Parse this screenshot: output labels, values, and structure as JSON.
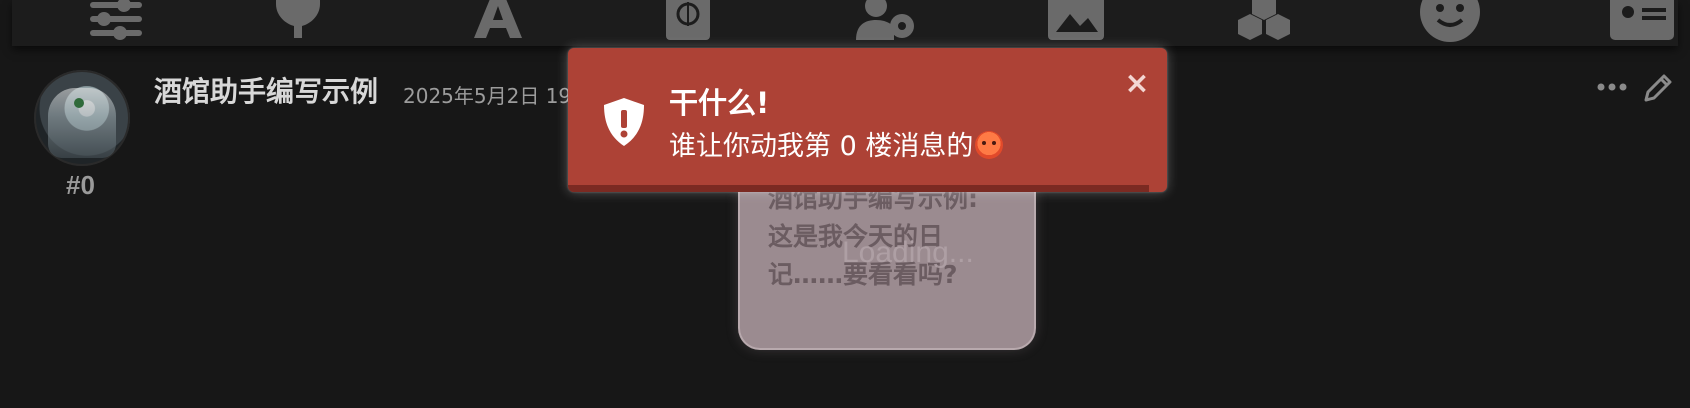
{
  "colors": {
    "background": "#171717",
    "toolbar": "#1c1c1c",
    "toolbar_icon": "#6a6a6a",
    "toast_background": "#ad4236",
    "toast_progress": "#7b2a22",
    "bubble_background": "#9b8b90"
  },
  "toolbar": {
    "icons": [
      "sliders-icon",
      "plug-icon",
      "font-icon",
      "book-atlas-icon",
      "user-gear-icon",
      "image-icon",
      "cubes-icon",
      "smile-icon",
      "address-card-icon"
    ]
  },
  "message": {
    "index": "#0",
    "character_name": "酒馆助手编写示例",
    "timestamp": "2025年5月2日 19",
    "bubble_text": "酒馆助手编写示例: 这是我今天的日记……要看看吗?",
    "loading_text": "Loading..."
  },
  "toast": {
    "type": "error",
    "icon": "shield-exclamation-icon",
    "title": "干什么!",
    "message": "谁让你动我第 0 楼消息的",
    "emoji": "angry-face-emoji",
    "close_symbol": "×",
    "progress_remaining": 0.97
  }
}
